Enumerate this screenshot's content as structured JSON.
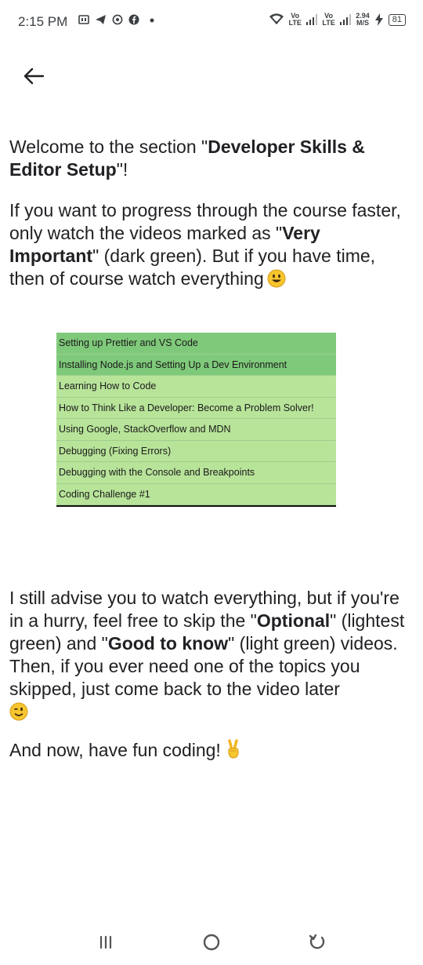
{
  "status_bar": {
    "time": "2:15 PM",
    "left_icons": [
      "sim-card-icon",
      "telegram-icon",
      "whatsapp-icon",
      "facebook-icon",
      "dot-icon"
    ],
    "network1_top": "Vo",
    "network1_bottom": "LTE",
    "network2_top": "Vo",
    "network2_bottom": "LTE",
    "speed_value": "2.94",
    "speed_unit": "M/S",
    "battery": "81"
  },
  "content": {
    "welcome_pre": "Welcome to the section \"",
    "welcome_bold": "Developer Skills & Editor Setup",
    "welcome_post": "\"!",
    "progress_pre": "If you want to progress through the course faster, only watch the videos marked as \"",
    "progress_bold": "Very Important",
    "progress_post": "\" (dark green). But if you have time, then of course watch everything",
    "advise_1": "I still advise you to watch everything, but if you're in a hurry, feel free to skip the \"",
    "advise_bold_1": "Optional",
    "advise_2": "\" (lightest green) and \"",
    "advise_bold_2": "Good to know",
    "advise_3": "\" (light green) videos. Then, if you ever need one of the topics you skipped, just come back to the video later",
    "fun_text": "And now, have fun coding!"
  },
  "lecture_list": [
    {
      "title": "Setting up Prettier and VS Code",
      "level": "Very Important",
      "color": "#7fc97a"
    },
    {
      "title": "Installing Node.js and Setting Up a Dev Environment",
      "level": "Very Important",
      "color": "#7fc97a"
    },
    {
      "title": "Learning How to Code",
      "level": "light green",
      "color": "#b8e49a"
    },
    {
      "title": "How to Think Like a Developer: Become a Problem Solver!",
      "level": "light green",
      "color": "#b8e49a"
    },
    {
      "title": "Using Google, StackOverflow and MDN",
      "level": "light green",
      "color": "#b8e49a"
    },
    {
      "title": "Debugging (Fixing Errors)",
      "level": "light green",
      "color": "#b8e49a"
    },
    {
      "title": "Debugging with the Console and Breakpoints",
      "level": "light green",
      "color": "#b8e49a"
    },
    {
      "title": "Coding Challenge #1",
      "level": "light green",
      "color": "#b8e49a"
    }
  ],
  "nav": {
    "icons": [
      "recent-apps-icon",
      "home-icon",
      "back-icon"
    ]
  }
}
